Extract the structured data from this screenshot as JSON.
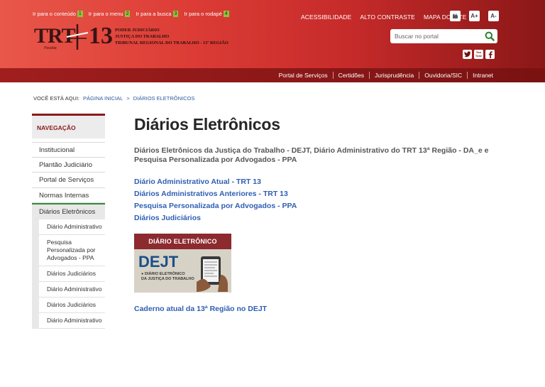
{
  "skip_links": [
    {
      "label": "Ir para o conteúdo",
      "key": "1"
    },
    {
      "label": "Ir para o menu",
      "key": "2"
    },
    {
      "label": "Ir para a busca",
      "key": "3"
    },
    {
      "label": "Ir para o rodapé",
      "key": "4"
    }
  ],
  "top_links": [
    "ACESSIBILIDADE",
    "ALTO CONTRASTE",
    "MAPA DO SITE"
  ],
  "font_controls": {
    "increase": "A+",
    "decrease": "A-"
  },
  "logo": {
    "trt": "TRT",
    "number": "13",
    "sub": "Paraíba",
    "lines": [
      "PODER JUDICIÁRIO",
      "JUSTIÇA DO TRABALHO",
      "TRIBUNAL REGIONAL DO TRABALHO - 13ª REGIÃO"
    ]
  },
  "search": {
    "placeholder": "Buscar no portal"
  },
  "social": {
    "youtube": "You Tube"
  },
  "subnav": [
    "Portal de Serviços",
    "Certidões",
    "Jurisprudência",
    "Ouvidoria/SIC",
    "Intranet"
  ],
  "breadcrumb": {
    "label": "VOCÊ ESTÁ AQUI:",
    "home": "PÁGINA INICIAL",
    "separator": ">",
    "current": "DIÁRIOS ELETRÔNICOS"
  },
  "sidebar": {
    "heading": "NAVEGAÇÃO",
    "items": [
      "Institucional",
      "Plantão Judiciário",
      "Portal de Serviços",
      "Normas Internas"
    ],
    "active": "Diários Eletrônicos",
    "subitems": [
      "Diário Administrativo",
      "Pesquisa Personalizada por Advogados - PPA",
      "Diários Judiciários",
      "Diário Administrativo",
      "Diários Judiciários",
      "Diário Administrativo"
    ]
  },
  "main": {
    "title": "Diários Eletrônicos",
    "description": "Diários Eletrônicos da Justiça do Trabalho - DEJT, Diário Administrativo do TRT 13ª Região - DA_e e Pesquisa Personalizada por Advogados - PPA",
    "links": [
      "Diário Administrativo Atual - TRT 13",
      "Diários Administrativos Anteriores - TRT 13",
      "Pesquisa Personalizada por Advogados - PPA",
      "Diários Judiciários"
    ],
    "banner": {
      "title": "DIÁRIO ELETRÔNICO",
      "logo": "DEJT",
      "sub1": "● DIÁRIO ELETRÔNICO",
      "sub2": "DA JUSTIÇA DO TRABALHO"
    },
    "caderno": "Caderno atual da 13ª Região no DEJT"
  },
  "colors": {
    "header_red": "#dc3c35",
    "dark_red": "#8a1b1b",
    "link_blue": "#2f5fb3",
    "active_green": "#3a8a3a"
  }
}
